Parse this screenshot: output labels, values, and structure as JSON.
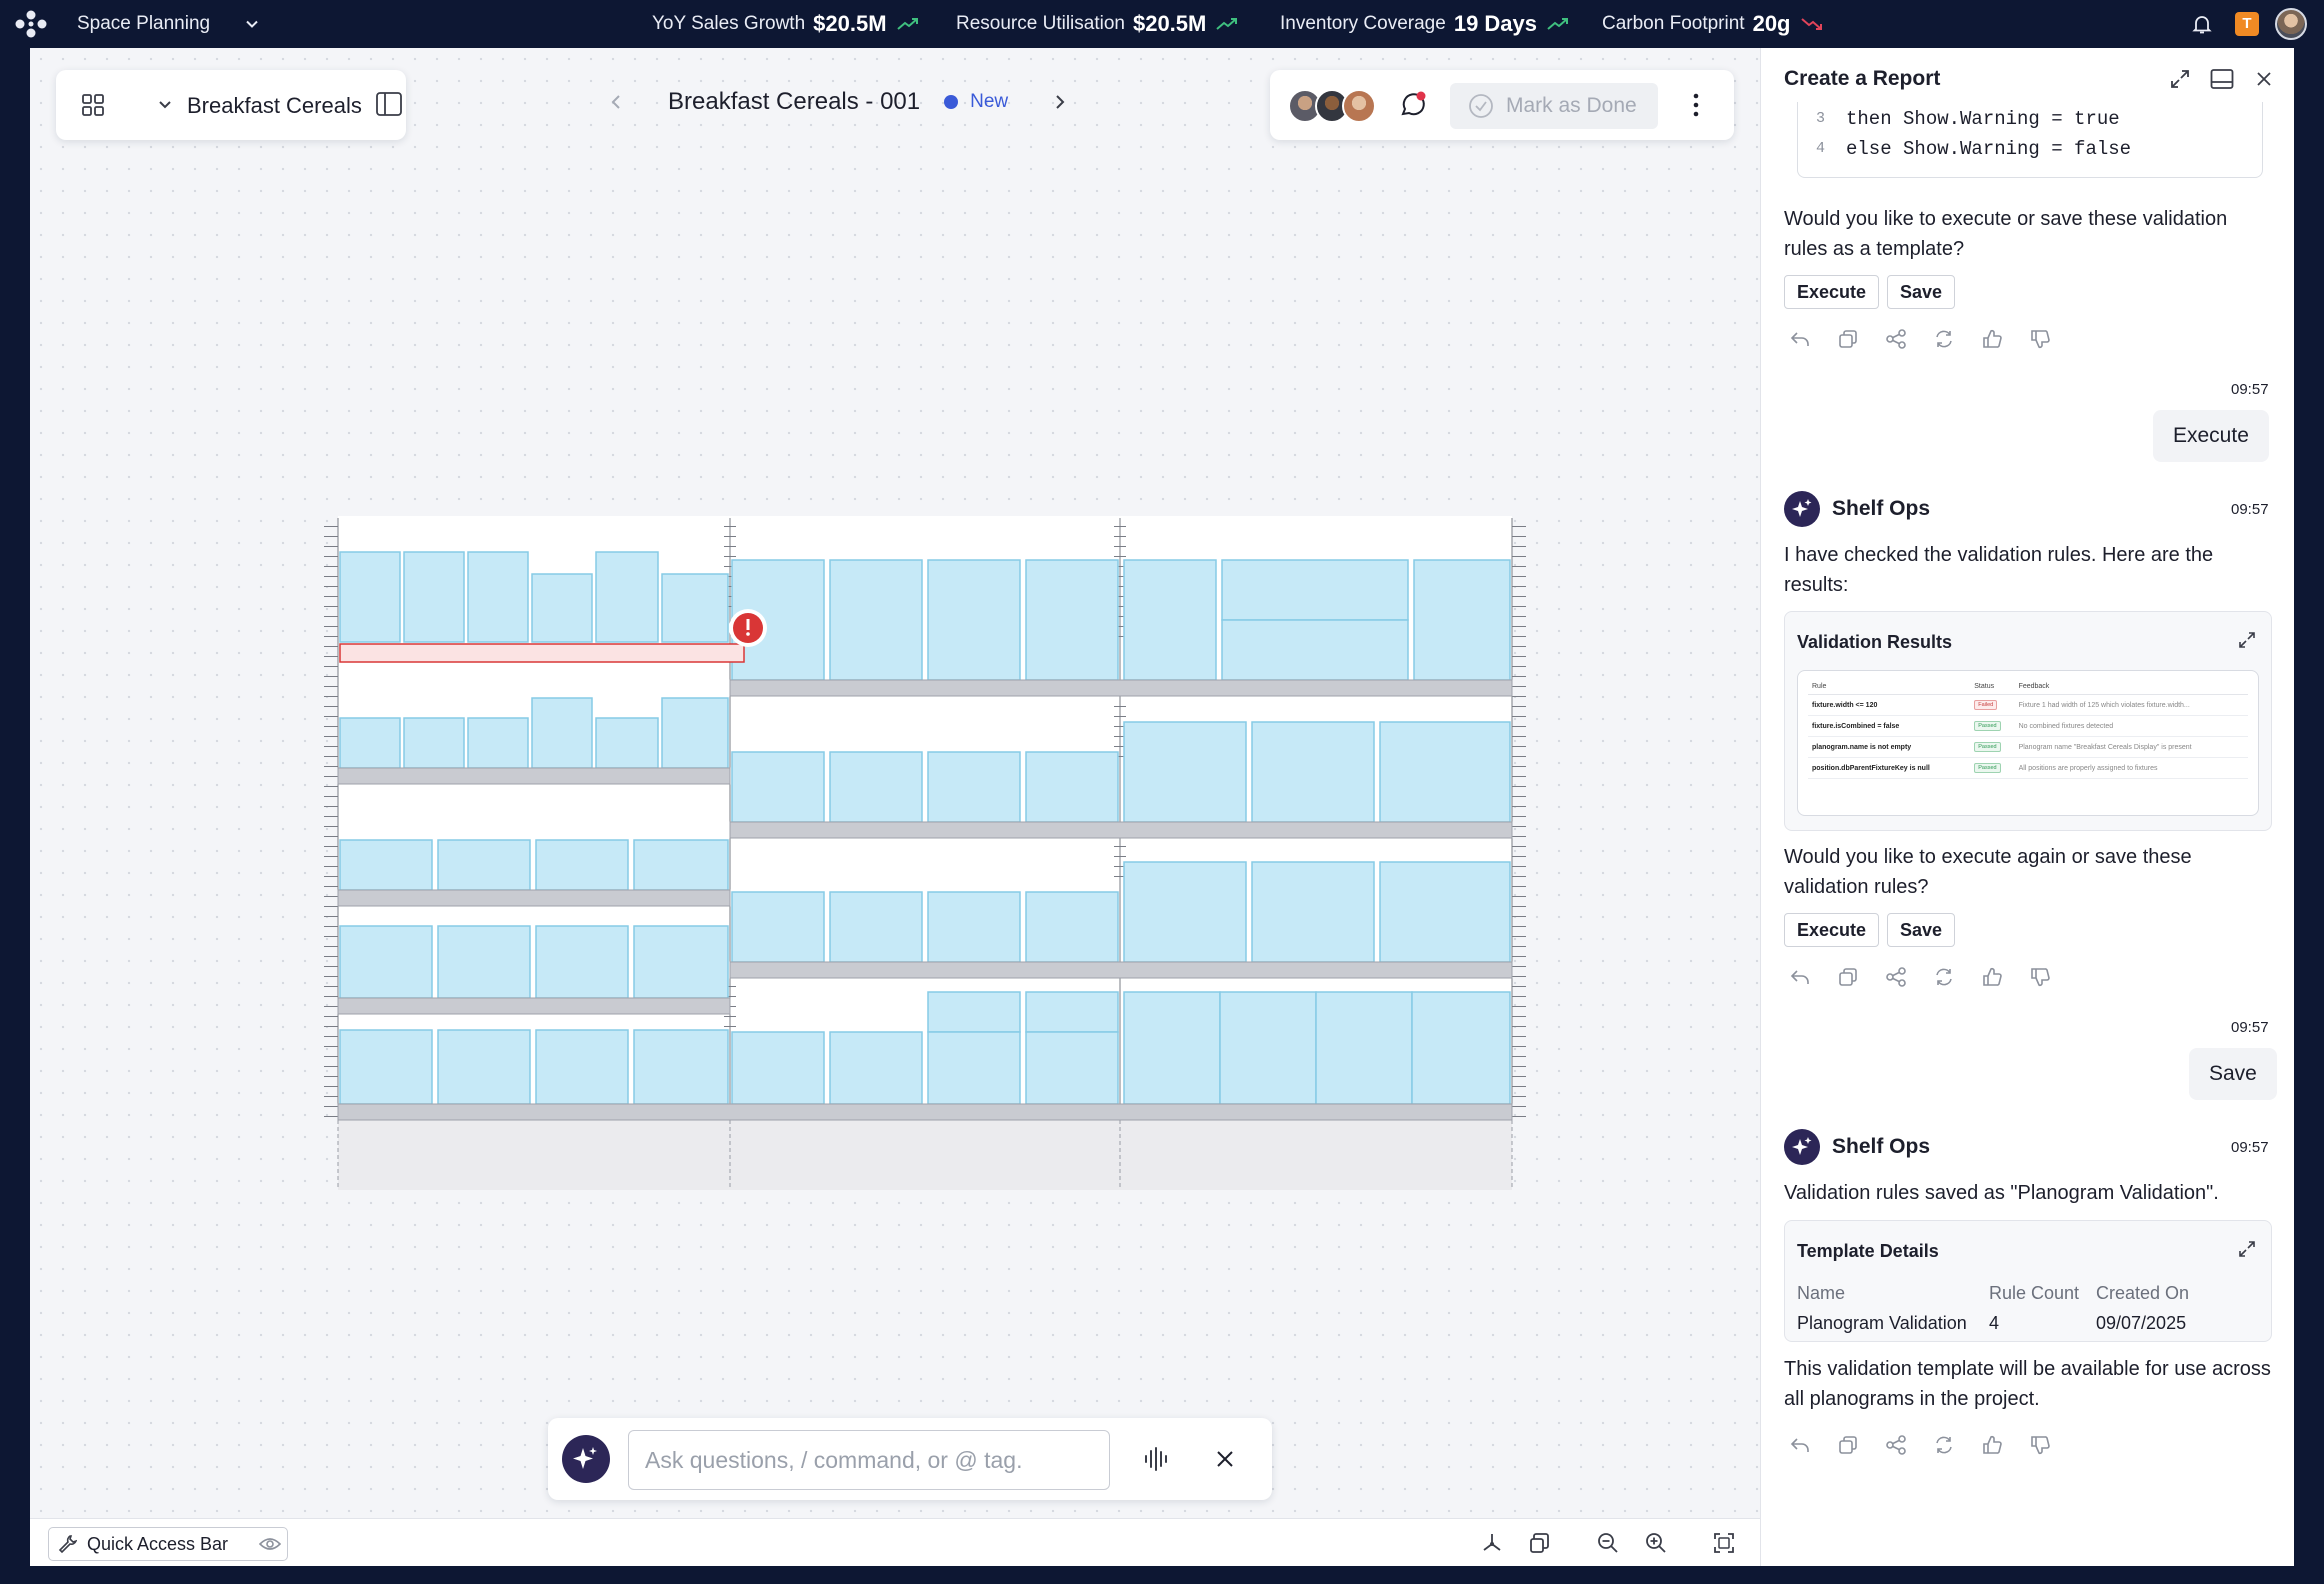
{
  "topbar": {
    "app_title": "Space Planning",
    "kpis": [
      {
        "label": "YoY Sales Growth",
        "value": "$20.5M",
        "trend": "up"
      },
      {
        "label": "Resource Utilisation",
        "value": "$20.5M",
        "trend": "up"
      },
      {
        "label": "Inventory Coverage",
        "value": "19 Days",
        "trend": "up"
      },
      {
        "label": "Carbon Footprint",
        "value": "20g",
        "trend": "down"
      }
    ],
    "user_badge": "T",
    "colors": {
      "bar_bg": "#0d1733",
      "trend_up": "#3fbf7f",
      "trend_down": "#e0445a",
      "badge": "#f08a24"
    }
  },
  "toolbar": {
    "planogram_name": "Breakfast Cereals",
    "title": "Breakfast Cereals - 001",
    "status": "New",
    "status_color": "#3a5ad8",
    "mark_done": "Mark as Done"
  },
  "ask": {
    "placeholder": "Ask questions, / command, or @ tag."
  },
  "bottombar": {
    "quick_access": "Quick Access Bar"
  },
  "panel": {
    "title": "Create a Report",
    "code_lines": [
      {
        "num": "3",
        "text": "then Show.Warning = true"
      },
      {
        "num": "4",
        "text": "else Show.Warning = false"
      }
    ],
    "msg1": "Would you like to execute or save these validation rules as a template?",
    "execute": "Execute",
    "save": "Save",
    "time": "09:57",
    "user_msg1": "Execute",
    "bot_name": "Shelf Ops",
    "msg2": "I have checked the validation rules. Here are the results:",
    "validation": {
      "title": "Validation Results",
      "headers": [
        "Rule",
        "Status",
        "Feedback"
      ],
      "rows": [
        {
          "rule": "fixture.width <= 120",
          "status": "Failed",
          "feedback": "Fixture 1 had width of 125 which violates fixture.width..."
        },
        {
          "rule": "fixture.isCombined = false",
          "status": "Passed",
          "feedback": "No combined fixtures detected"
        },
        {
          "rule": "planogram.name is not empty",
          "status": "Passed",
          "feedback": "Planogram name \"Breakfast Cereals Display\" is present"
        },
        {
          "rule": "position.dbParentFixtureKey is null",
          "status": "Passed",
          "feedback": "All positions are properly assigned to fixtures"
        }
      ]
    },
    "msg3": "Would you like to execute again or save these validation rules?",
    "user_msg2": "Save",
    "msg4": "Validation rules saved as \"Planogram Validation\".",
    "template": {
      "title": "Template Details",
      "headers": [
        "Name",
        "Rule Count",
        "Created On"
      ],
      "values": [
        "Planogram Validation",
        "4",
        "09/07/2025"
      ]
    },
    "msg5": "This validation template will be available for use across all planograms in the project."
  },
  "planogram": {
    "colors": {
      "product_fill": "#c6e9f7",
      "product_stroke": "#7ec8e6",
      "shelf": "#c9cbd1",
      "error": "#d93636",
      "error_fill": "#fbe3e3"
    }
  }
}
